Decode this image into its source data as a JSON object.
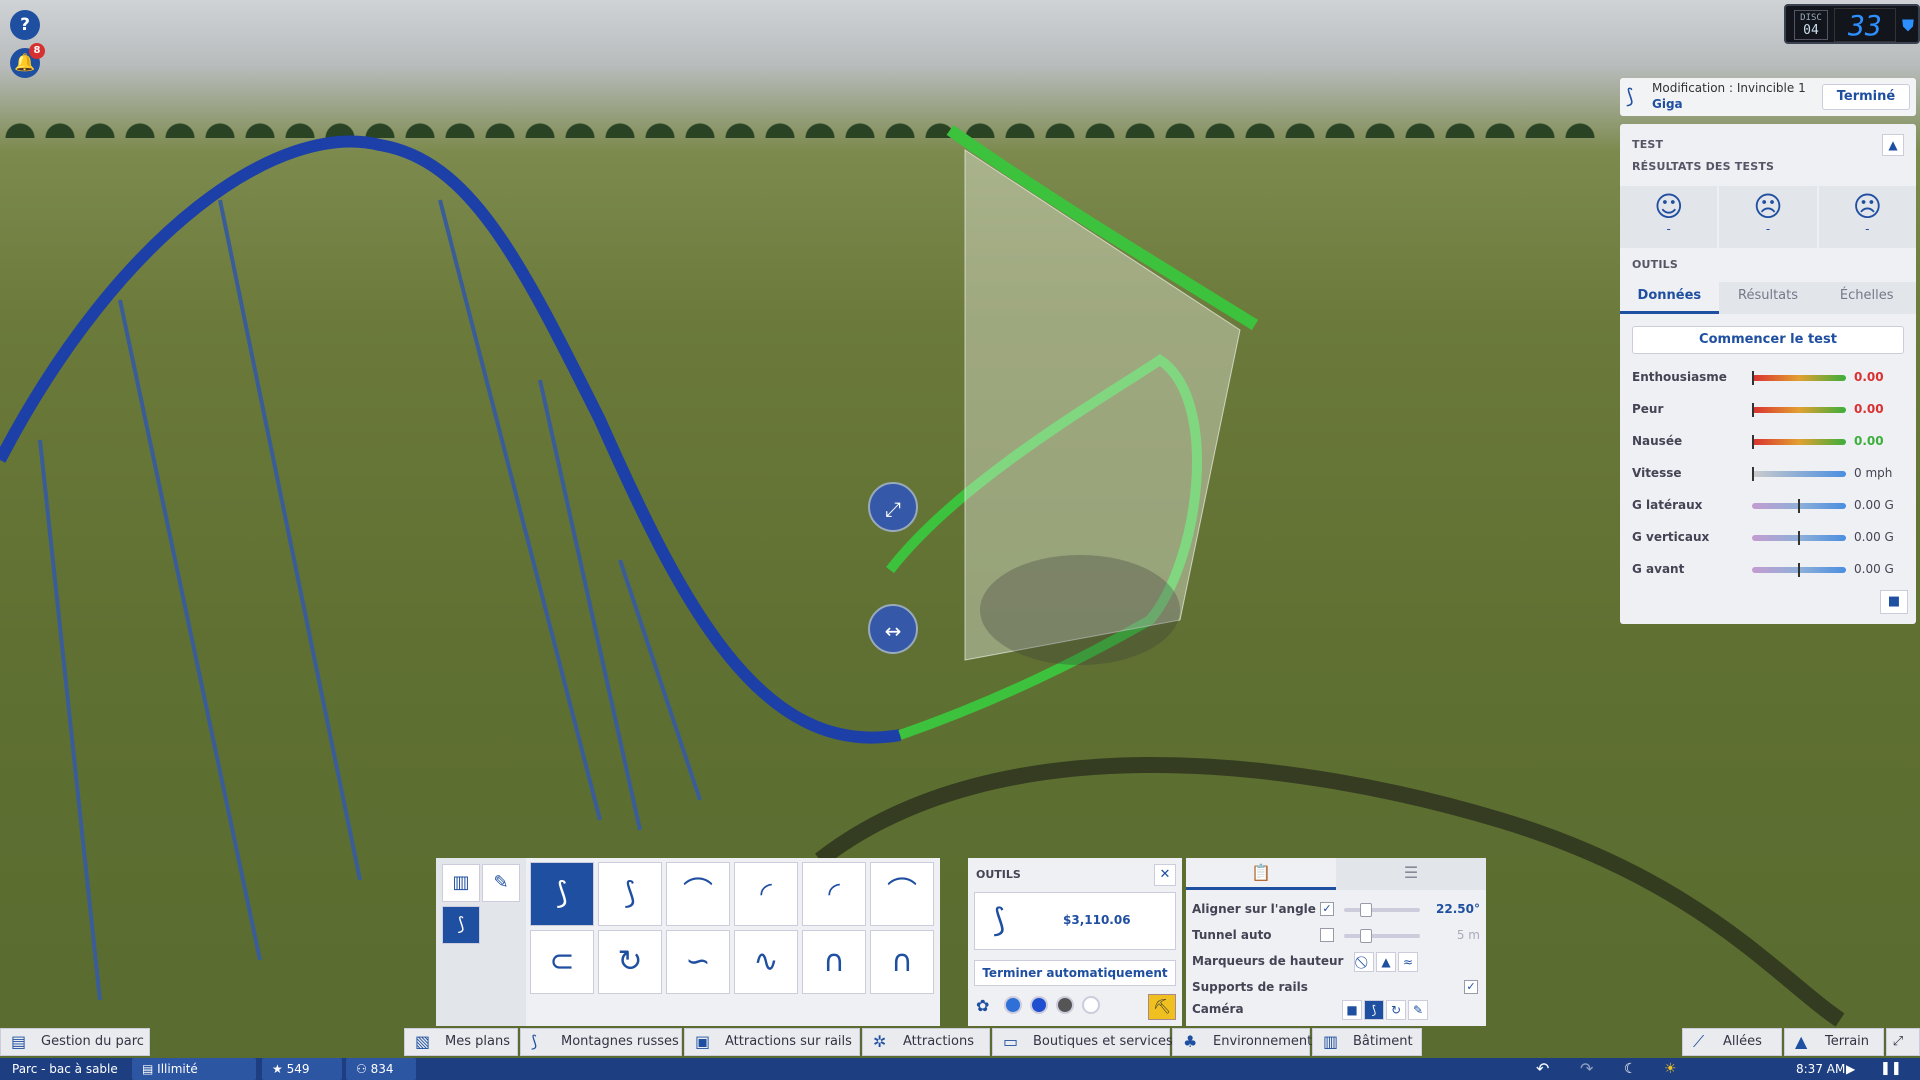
{
  "hud": {
    "help_icon": "?",
    "notif_count": "8",
    "speed_small_top": "DISC",
    "speed_small_val": "04",
    "speed_value": "33"
  },
  "modify_bar": {
    "title": "Modification : Invincible 1",
    "name": "Giga",
    "done_label": "Terminé"
  },
  "test_panel": {
    "section_test": "TEST",
    "section_results": "RÉSULTATS DES TESTS",
    "faces": [
      {
        "icon": "happy-face-icon",
        "value": "-"
      },
      {
        "icon": "neutral-face-icon",
        "value": "-"
      },
      {
        "icon": "sad-face-icon",
        "value": "-"
      }
    ],
    "section_tools": "OUTILS",
    "tabs": [
      "Données",
      "Résultats",
      "Échelles"
    ],
    "start_test_label": "Commencer le test",
    "stats": [
      {
        "label": "Enthousiasme",
        "value": "0.00",
        "fill": 0.0
      },
      {
        "label": "Peur",
        "value": "0.00",
        "fill": 0.0
      },
      {
        "label": "Nausée",
        "value": "0.00",
        "fill": 0.0
      },
      {
        "label": "Vitesse",
        "value": "0 mph",
        "fill": 0.0
      },
      {
        "label": "G latéraux",
        "value": "0.00 G",
        "fill": 0.5
      },
      {
        "label": "G verticaux",
        "value": "0.00 G",
        "fill": 0.5
      },
      {
        "label": "G avant",
        "value": "0.00 G",
        "fill": 0.5
      }
    ]
  },
  "tools_panel": {
    "title": "OUTILS",
    "price": "$3,110.06",
    "auto_complete_label": "Terminer automatiquement",
    "swatches": [
      "#2e6fd8",
      "#1f4fd0",
      "#555555",
      "#ffffff"
    ]
  },
  "settings_panel": {
    "align_label": "Aligner sur l'angle",
    "align_value": "22.50°",
    "tunnel_label": "Tunnel auto",
    "tunnel_value": "5 m",
    "height_markers_label": "Marqueurs de hauteur",
    "supports_label": "Supports de rails",
    "camera_label": "Caméra"
  },
  "toolbar": {
    "park_manage": "Gestion du parc",
    "blueprints": "Mes plans",
    "coasters": "Montagnes russes",
    "track_rides": "Attractions sur rails",
    "attractions": "Attractions",
    "shops": "Boutiques et services",
    "environment": "Environnement",
    "building": "Bâtiment",
    "paths": "Allées",
    "terrain": "Terrain"
  },
  "status": {
    "park_name": "Parc - bac à sable",
    "money": "Illimité",
    "rating": "549",
    "guests": "834",
    "time": "8:37 AM"
  }
}
